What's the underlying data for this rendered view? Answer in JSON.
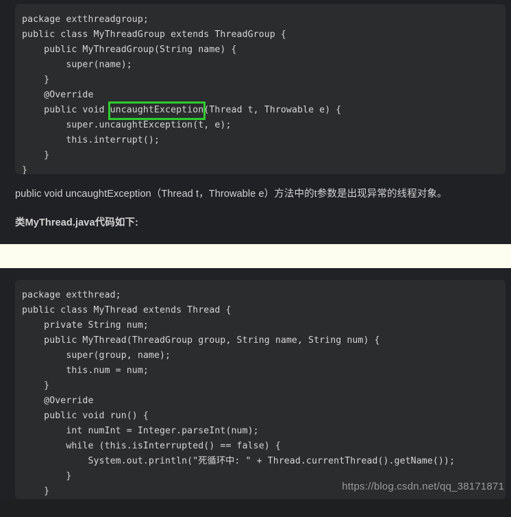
{
  "page": {
    "background_color": "#1e1f21",
    "section_background_color": "#202124",
    "code_background_color": "#2b2c2e",
    "code_text_color": "#d6d6d6",
    "highlight_color": "#2ecc2e",
    "divider_color": "#fdfdf0"
  },
  "code_block_1": {
    "language": "java",
    "lines": [
      "package extthreadgroup;",
      "public class MyThreadGroup extends ThreadGroup {",
      "    public MyThreadGroup(String name) {",
      "        super(name);",
      "    }",
      "    @Override",
      "    public void ",
      "        super.uncaughtException(t, e);",
      "        this.interrupt();",
      "    }",
      "}"
    ],
    "highlighted_line_prefix": "    public void ",
    "highlighted_token": "uncaughtException",
    "highlighted_line_suffix": "(Thread t, Throwable e) {"
  },
  "prose": {
    "line_1": "public void uncaughtException（Thread t，Throwable e）方法中的t参数是出现异常的线程对象。",
    "line_2": "类MyThread.java代码如下:"
  },
  "code_block_2": {
    "language": "java",
    "lines": [
      "package extthread;",
      "public class MyThread extends Thread {",
      "    private String num;",
      "    public MyThread(ThreadGroup group, String name, String num) {",
      "        super(group, name);",
      "        this.num = num;",
      "    }",
      "    @Override",
      "    public void run() {",
      "        int numInt = Integer.parseInt(num);",
      "        while (this.isInterrupted() == false) {",
      "            System.out.println(\"死循环中: \" + Thread.currentThread().getName());",
      "        }",
      "    }",
      "}"
    ]
  },
  "watermark": {
    "text": "https://blog.csdn.net/qq_38171871"
  }
}
